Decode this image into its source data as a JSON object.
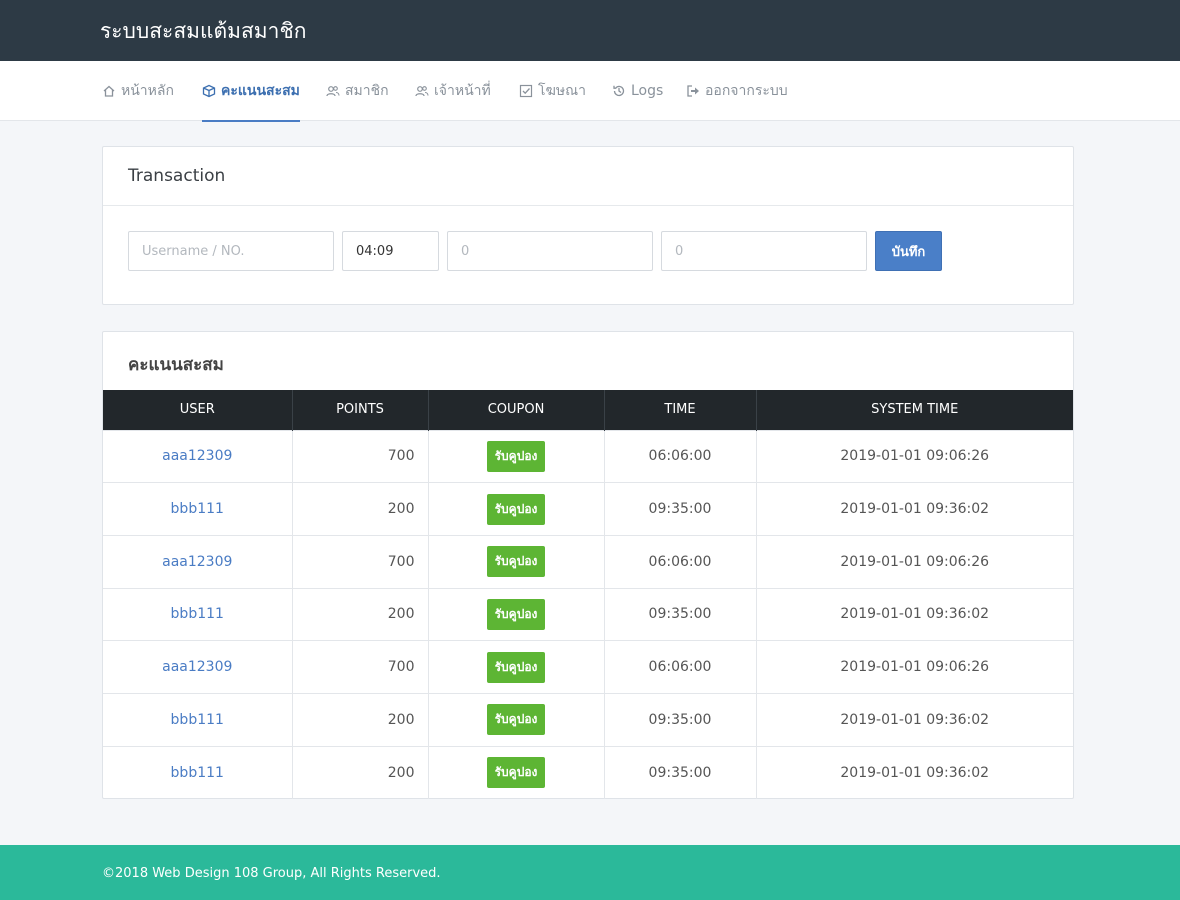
{
  "app": {
    "title": "ระบบสะสมแต้มสมาชิก"
  },
  "nav": {
    "items": [
      {
        "label": "หน้าหลัก",
        "icon": "home-icon"
      },
      {
        "label": "คะแนนสะสม",
        "icon": "box-icon",
        "active": true
      },
      {
        "label": "สมาชิก",
        "icon": "users-icon"
      },
      {
        "label": "เจ้าหน้าที่",
        "icon": "staff-icon"
      },
      {
        "label": "โฆษณา",
        "icon": "checkbox-icon"
      },
      {
        "label": "Logs",
        "icon": "history-icon"
      },
      {
        "label": "ออกจากระบบ",
        "icon": "sign-out-icon"
      }
    ]
  },
  "transaction": {
    "title": "Transaction",
    "username_placeholder": "Username / NO.",
    "time_value": "04:09",
    "amount_placeholder": "0",
    "points_placeholder": "0",
    "save_label": "บันทึก"
  },
  "points_table": {
    "title": "คะแนนสะสม",
    "headers": [
      "USER",
      "POINTS",
      "COUPON",
      "TIME",
      "SYSTEM TIME"
    ],
    "rows": [
      {
        "user": "aaa12309",
        "points": "700",
        "coupon": "รับคูปอง",
        "time": "06:06:00",
        "system_time": "2019-01-01 09:06:26"
      },
      {
        "user": "bbb111",
        "points": "200",
        "coupon": "รับคูปอง",
        "time": "09:35:00",
        "system_time": "2019-01-01 09:36:02"
      },
      {
        "user": "aaa12309",
        "points": "700",
        "coupon": "รับคูปอง",
        "time": "06:06:00",
        "system_time": "2019-01-01 09:06:26"
      },
      {
        "user": "bbb111",
        "points": "200",
        "coupon": "รับคูปอง",
        "time": "09:35:00",
        "system_time": "2019-01-01 09:36:02"
      },
      {
        "user": "aaa12309",
        "points": "700",
        "coupon": "รับคูปอง",
        "time": "06:06:00",
        "system_time": "2019-01-01 09:06:26"
      },
      {
        "user": "bbb111",
        "points": "200",
        "coupon": "รับคูปอง",
        "time": "09:35:00",
        "system_time": "2019-01-01 09:36:02"
      },
      {
        "user": "bbb111",
        "points": "200",
        "coupon": "รับคูปอง",
        "time": "09:35:00",
        "system_time": "2019-01-01 09:36:02"
      }
    ]
  },
  "footer": {
    "text": "©2018 Web Design 108 Group, All Rights Reserved."
  },
  "colors": {
    "topbar": "#2d3a45",
    "accent": "#4a7cc4",
    "badge": "#5db534",
    "footer": "#2bb99a"
  }
}
